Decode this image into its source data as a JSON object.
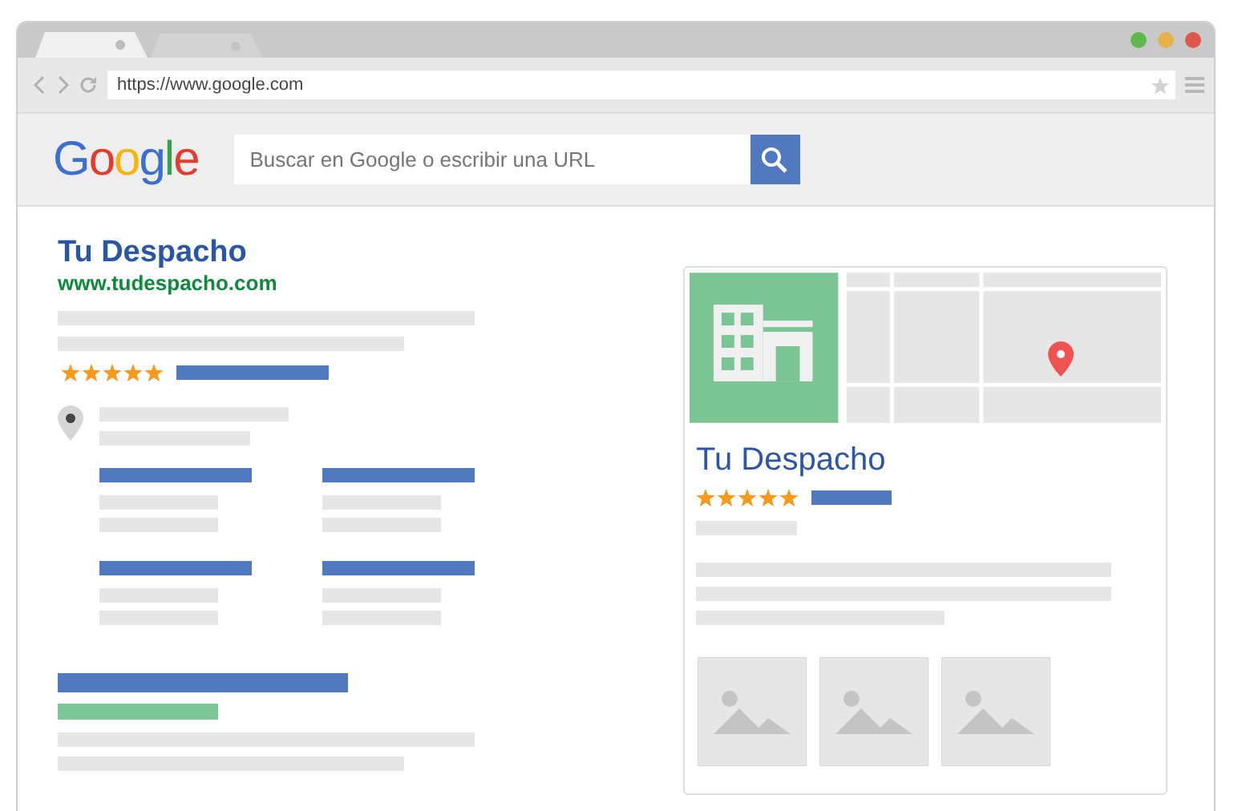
{
  "window": {
    "tabs": [
      {
        "selected": true
      },
      {
        "selected": false
      }
    ],
    "window_controls": [
      {
        "color": "#5fb84c"
      },
      {
        "color": "#e8b04b"
      },
      {
        "color": "#e0574c"
      }
    ]
  },
  "address_bar": {
    "url": "https://www.google.com"
  },
  "header": {
    "logo": "Google",
    "search": {
      "placeholder": "Buscar en Google o escribir una URL"
    }
  },
  "result": {
    "title": "Tu Despacho",
    "url": "www.tudespacho.com",
    "stars": 5
  },
  "business_card": {
    "title": "Tu Despacho",
    "stars": 5
  }
}
